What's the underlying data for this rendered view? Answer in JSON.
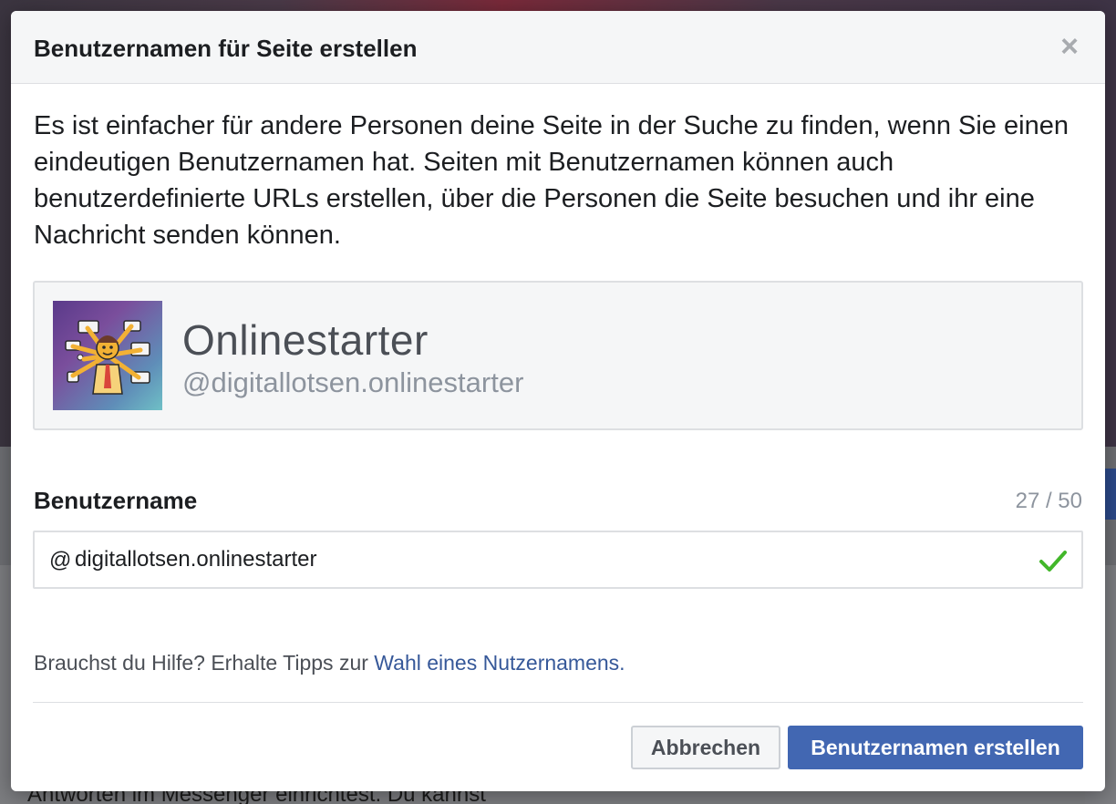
{
  "modal": {
    "title": "Benutzernamen für Seite erstellen",
    "close_symbol": "×",
    "intro": "Es ist einfacher für andere Personen deine Seite in der Suche zu finden, wenn Sie einen eindeutigen Benutzernamen hat. Seiten mit Benutzernamen können auch benutzerdefinierte URLs erstellen, über die Personen die Seite besuchen und ihr eine Nachricht senden können."
  },
  "preview": {
    "page_name": "Onlinestarter",
    "handle": "@digitallotsen.onlinestarter"
  },
  "username_field": {
    "label": "Benutzername",
    "char_count": "27 / 50",
    "prefix": "@",
    "value": "digitallotsen.onlinestarter",
    "valid": true
  },
  "help": {
    "text": "Brauchst du Hilfe? Erhalte Tipps zur ",
    "link": "Wahl eines Nutzernamens."
  },
  "buttons": {
    "cancel": "Abbrechen",
    "submit": "Benutzernamen erstellen"
  },
  "background": {
    "snippet": "Antworten im Messenger einrichtest. Du kannst"
  },
  "colors": {
    "primary": "#4267b2",
    "link": "#365899",
    "success": "#42b72a"
  }
}
